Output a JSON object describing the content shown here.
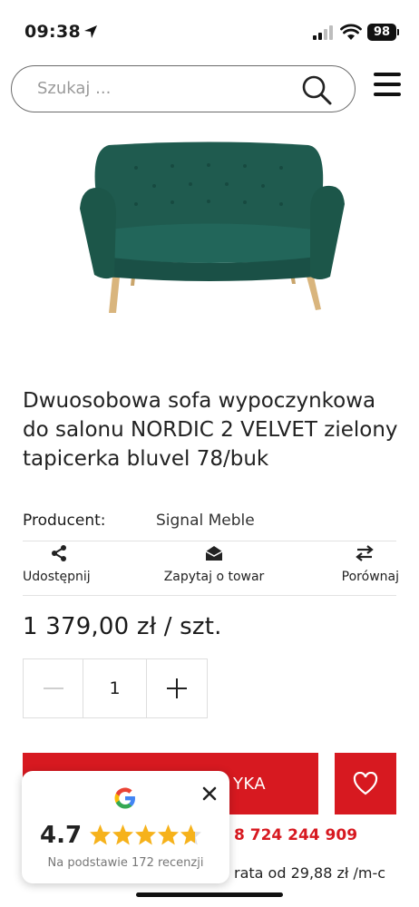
{
  "status_bar": {
    "time": "09:38",
    "battery": "98",
    "icons": [
      "location-arrow-icon",
      "signal-icon",
      "wifi-icon",
      "battery-icon"
    ]
  },
  "search": {
    "placeholder": "Szukaj ..."
  },
  "product": {
    "title": "Dwuosobowa sofa wypoczynkowa do salonu NORDIC 2 VELVET zielony tapicerka bluvel 78/buk",
    "producer_label": "Producent:",
    "producer_value": "Signal Meble",
    "price": "1 379,00 zł / szt.",
    "quantity": "1",
    "colors": {
      "sofa": "#1f5b4f",
      "legs": "#d9b57d"
    }
  },
  "actions": {
    "share": "Udostępnij",
    "ask": "Zapytaj o towar",
    "compare": "Porównaj"
  },
  "buy": {
    "label_visible": "YKA",
    "phone": "8 724 244 909",
    "installment": "rata od 29,88 zł /m-c"
  },
  "review_widget": {
    "rating": "4.7",
    "stars": 4.7,
    "subtitle": "Na podstawie 172 recenzji"
  },
  "colors": {
    "accent": "#d71920",
    "star": "#f6b21b",
    "text": "#1a1a1a"
  }
}
